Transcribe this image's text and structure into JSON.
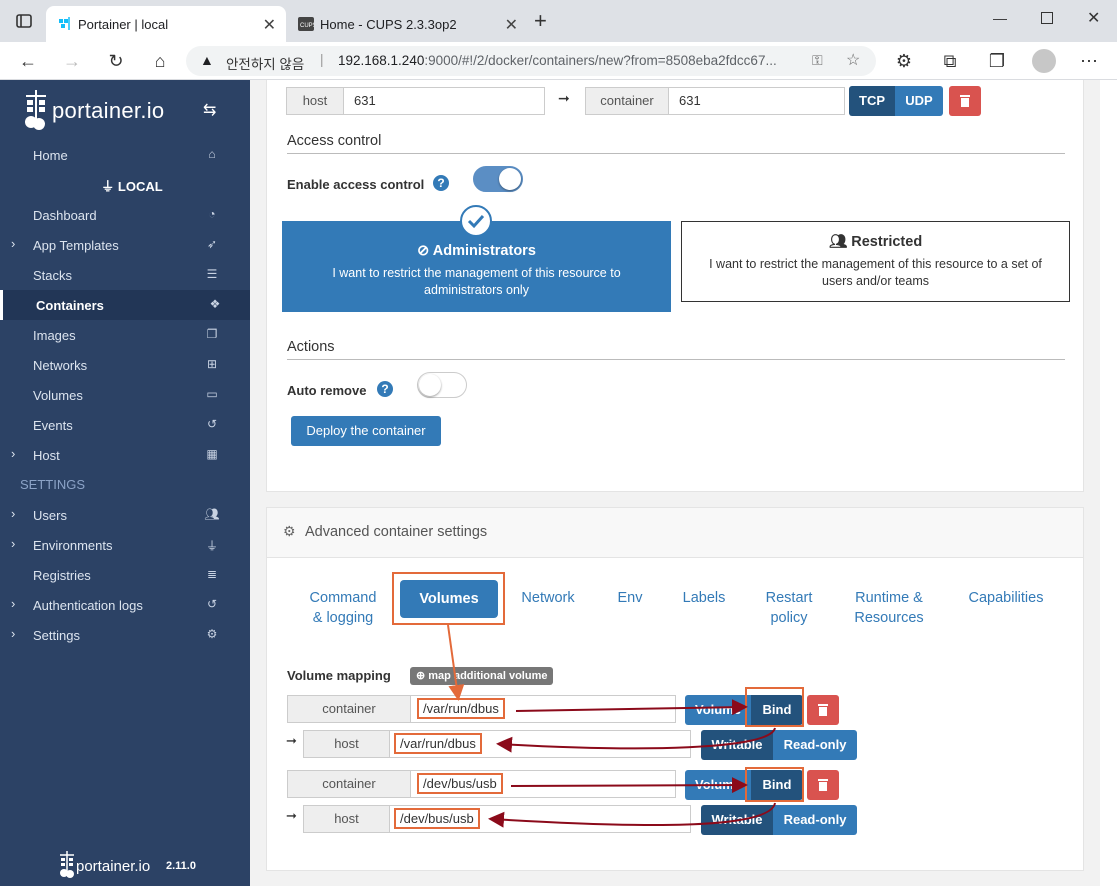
{
  "browser": {
    "tabs": [
      {
        "title": "Portainer | local",
        "active": true
      },
      {
        "title": "Home - CUPS 2.3.3op2",
        "active": false
      }
    ],
    "new_tab": "+",
    "address": {
      "security_label": "안전하지 않음",
      "url_host": "192.168.1.240",
      "url_rest": ":9000/#!/2/docker/containers/new?from=8508eba2fdcc67..."
    }
  },
  "sidebar": {
    "logo_text": "portainer.io",
    "home": "Home",
    "environment": "LOCAL",
    "items": [
      {
        "label": "Dashboard",
        "icon": "tachometer-icon",
        "chevron": false
      },
      {
        "label": "App Templates",
        "icon": "rocket-icon",
        "chevron": true
      },
      {
        "label": "Stacks",
        "icon": "list-icon",
        "chevron": false
      },
      {
        "label": "Containers",
        "icon": "cubes-icon",
        "chevron": false,
        "active": true
      },
      {
        "label": "Images",
        "icon": "clone-icon",
        "chevron": false
      },
      {
        "label": "Networks",
        "icon": "sitemap-icon",
        "chevron": false
      },
      {
        "label": "Volumes",
        "icon": "hdd-icon",
        "chevron": false
      },
      {
        "label": "Events",
        "icon": "history-icon",
        "chevron": false
      },
      {
        "label": "Host",
        "icon": "th-icon",
        "chevron": true
      }
    ],
    "settings_section": "SETTINGS",
    "settings_items": [
      {
        "label": "Users",
        "icon": "users-icon",
        "chevron": true
      },
      {
        "label": "Environments",
        "icon": "plug-icon",
        "chevron": true
      },
      {
        "label": "Registries",
        "icon": "database-icon",
        "chevron": false
      },
      {
        "label": "Authentication logs",
        "icon": "history-icon",
        "chevron": true
      },
      {
        "label": "Settings",
        "icon": "cogs-icon",
        "chevron": true
      }
    ],
    "footer_text": "portainer.io",
    "version": "2.11.0"
  },
  "port_mapping": {
    "host_addon": "host",
    "host_value": "631",
    "container_addon": "container",
    "container_value": "631",
    "tcp": "TCP",
    "udp": "UDP"
  },
  "access_control": {
    "section_title": "Access control",
    "enable_label": "Enable access control",
    "enabled": true,
    "admin_title": "Administrators",
    "admin_desc": "I want to restrict the management of this resource to administrators only",
    "restricted_title": "Restricted",
    "restricted_desc": "I want to restrict the management of this resource to a set of users and/or teams"
  },
  "actions": {
    "section_title": "Actions",
    "auto_remove_label": "Auto remove",
    "auto_remove": false,
    "deploy_button": "Deploy the container"
  },
  "advanced": {
    "title": "Advanced container settings",
    "tabs": [
      {
        "label": "Command\n& logging"
      },
      {
        "label": "Volumes",
        "active": true
      },
      {
        "label": "Network"
      },
      {
        "label": "Env"
      },
      {
        "label": "Labels"
      },
      {
        "label": "Restart\npolicy"
      },
      {
        "label": "Runtime &\nResources"
      },
      {
        "label": "Capabilities"
      }
    ],
    "volume_mapping_label": "Volume mapping",
    "map_button": "map additional volume",
    "volumes": [
      {
        "container_addon": "container",
        "container_path": "/var/run/dbus",
        "volume_btn": "Volume",
        "bind_btn": "Bind",
        "host_addon": "host",
        "host_path": "/var/run/dbus",
        "writable_btn": "Writable",
        "readonly_btn": "Read-only"
      },
      {
        "container_addon": "container",
        "container_path": "/dev/bus/usb",
        "volume_btn": "Volume",
        "bind_btn": "Bind",
        "host_addon": "host",
        "host_path": "/dev/bus/usb",
        "writable_btn": "Writable",
        "readonly_btn": "Read-only"
      }
    ]
  },
  "colors": {
    "sidebar_bg": "#2c4265",
    "primary": "#337ab7",
    "primary_dark": "#23527c",
    "danger": "#d9534f",
    "annotation": "#e36a3a",
    "arrow": "#8b0a1a"
  }
}
